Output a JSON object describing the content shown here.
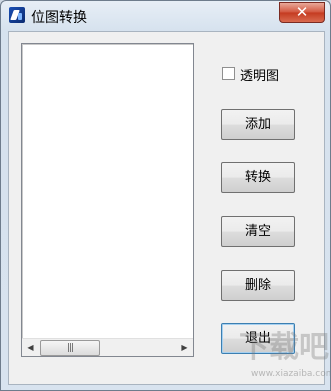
{
  "window": {
    "title": "位图转换",
    "close_symbol": "✕"
  },
  "list": {
    "scroll_left": "◀",
    "scroll_right": "▶",
    "thumb_grip": "|||"
  },
  "transparent_checkbox": {
    "label": "透明图",
    "checked": false
  },
  "buttons": {
    "add": "添加",
    "convert": "转换",
    "clear": "清空",
    "delete": "删除",
    "exit": "退出"
  },
  "watermark": {
    "text": "下载吧",
    "url": "www.xiazaiba.com"
  }
}
